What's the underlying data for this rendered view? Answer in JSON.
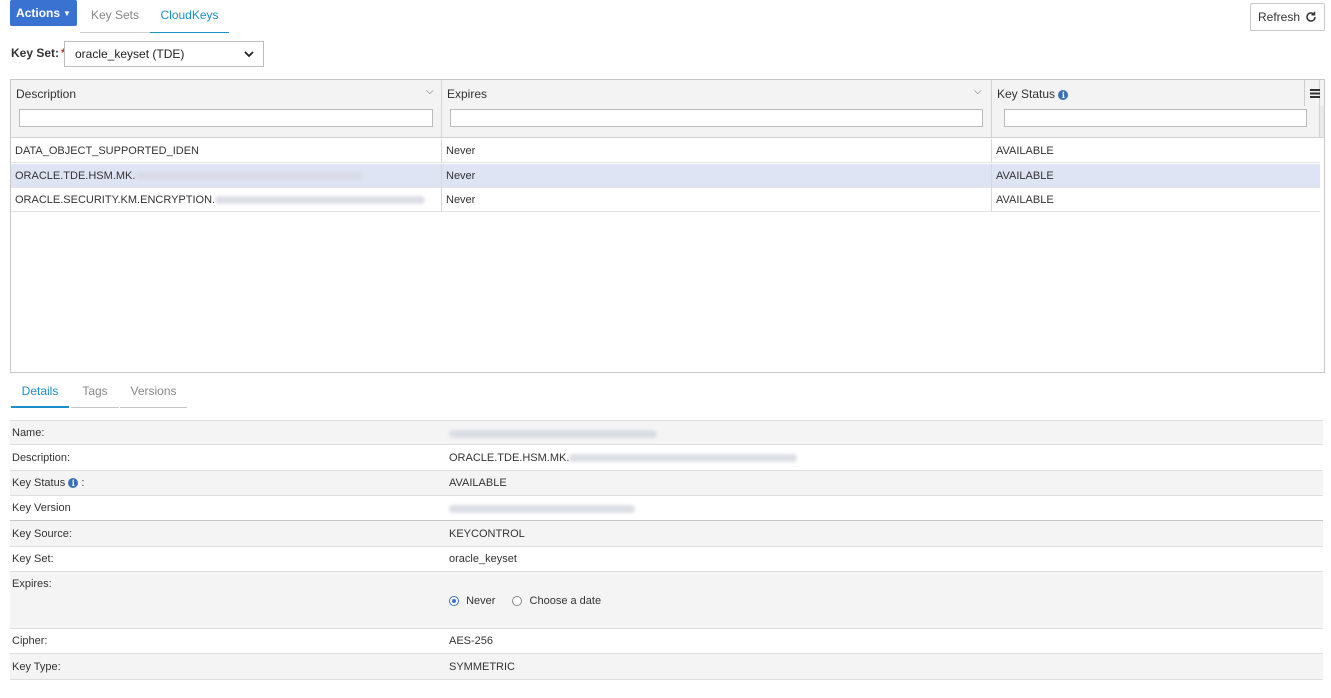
{
  "toolbar": {
    "actions_label": "Actions",
    "tabs": [
      "Key Sets",
      "CloudKeys"
    ],
    "refresh_label": "Refresh"
  },
  "keyset": {
    "label": "Key Set:",
    "required_mark": "*",
    "selected": "oracle_keyset (TDE)"
  },
  "grid": {
    "columns": [
      "Description",
      "Expires",
      "Key Status"
    ],
    "rows": [
      {
        "description": "DATA_OBJECT_SUPPORTED_IDEN",
        "expires": "Never",
        "status": "AVAILABLE"
      },
      {
        "description": "ORACLE.TDE.HSM.MK.",
        "expires": "Never",
        "status": "AVAILABLE"
      },
      {
        "description": "ORACLE.SECURITY.KM.ENCRYPTION.",
        "expires": "Never",
        "status": "AVAILABLE"
      }
    ]
  },
  "details": {
    "tabs": [
      "Details",
      "Tags",
      "Versions"
    ],
    "fields": {
      "name_label": "Name:",
      "description_label": "Description:",
      "description_value": "ORACLE.TDE.HSM.MK.",
      "key_status_label": "Key Status",
      "key_status_suffix": ":",
      "key_status_value": "AVAILABLE",
      "key_version_label": "Key Version",
      "key_source_label": "Key Source:",
      "key_source_value": "KEYCONTROL",
      "key_set_label": "Key Set:",
      "key_set_value": "oracle_keyset",
      "expires_label": "Expires:",
      "expires_never": "Never",
      "expires_choose": "Choose a date",
      "cipher_label": "Cipher:",
      "cipher_value": "AES-256",
      "key_type_label": "Key Type:",
      "key_type_value": "SYMMETRIC"
    }
  },
  "colors": {
    "primary": "#3a72d1",
    "tab_active": "#1a8fc9",
    "selected_row": "#dfe4f4",
    "info_icon": "#3a6fb8"
  }
}
